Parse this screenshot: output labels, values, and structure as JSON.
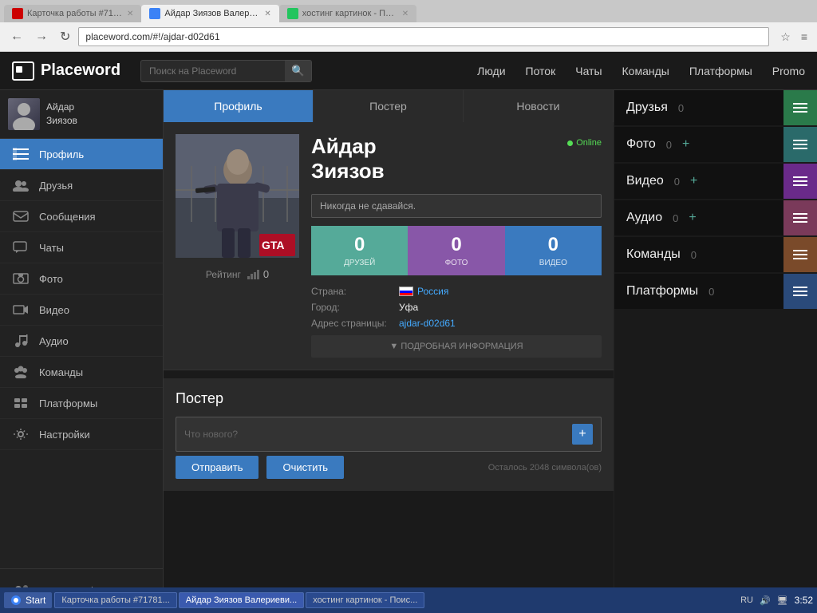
{
  "browser": {
    "tabs": [
      {
        "label": "Карточка работы #71781...",
        "favicon_color": "#c00",
        "active": false
      },
      {
        "label": "Айдар Зиязов Валериеви...",
        "favicon_color": "#3b82f6",
        "active": true
      },
      {
        "label": "хостинг картинок - Поис...",
        "favicon_color": "#22c55e",
        "active": false
      }
    ],
    "address": "placeword.com/#!/ajdar-d02d61",
    "back_btn": "←",
    "forward_btn": "→",
    "refresh_btn": "↻"
  },
  "navbar": {
    "logo": "Placeword",
    "search_placeholder": "Поиск на Placeword",
    "nav_links": [
      "Люди",
      "Поток",
      "Чаты",
      "Команды",
      "Платформы",
      "Promo"
    ]
  },
  "sidebar": {
    "user_name": "Айдар\nЗиязов",
    "items": [
      {
        "label": "Профиль",
        "icon": "☰",
        "active": true
      },
      {
        "label": "Друзья",
        "icon": "👥"
      },
      {
        "label": "Сообщения",
        "icon": "✉"
      },
      {
        "label": "Чаты",
        "icon": "💬"
      },
      {
        "label": "Фото",
        "icon": "🖼"
      },
      {
        "label": "Видео",
        "icon": "▶"
      },
      {
        "label": "Аудио",
        "icon": "♪"
      },
      {
        "label": "Команды",
        "icon": "👥"
      },
      {
        "label": "Платформы",
        "icon": "⬛"
      },
      {
        "label": "Настройки",
        "icon": "⚙"
      }
    ],
    "bottom_item": "Смена профиля"
  },
  "profile": {
    "tabs": [
      "Профиль",
      "Постер",
      "Новости"
    ],
    "active_tab": 0,
    "name": "Айдар\nЗиязов",
    "online_status": "Online",
    "motto": "Никогда не сдавайся.",
    "rating_label": "Рейтинг",
    "rating_value": "0",
    "stats": [
      {
        "number": "0",
        "label": "ДРУЗЕЙ",
        "color": "green"
      },
      {
        "number": "0",
        "label": "ФОТО",
        "color": "purple"
      },
      {
        "number": "0",
        "label": "ВИДЕО",
        "color": "blue"
      }
    ],
    "details": [
      {
        "key": "Страна:",
        "value": "Россия",
        "has_flag": true
      },
      {
        "key": "Город:",
        "value": "Уфа",
        "link": false
      },
      {
        "key": "Адрес страницы:",
        "value": "ajdar-d02d61",
        "link": true
      }
    ],
    "more_info": "▼ ПОДРОБНАЯ ИНФОРМАЦИЯ"
  },
  "poster": {
    "title": "Постер",
    "input_placeholder": "Что нового?",
    "submit_btn": "Отправить",
    "clear_btn": "Очистить",
    "chars_left": "Осталось 2048 символа(ов)"
  },
  "right_sidebar": {
    "widgets": [
      {
        "label": "Друзья",
        "count": "0",
        "has_add": false,
        "color": "green"
      },
      {
        "label": "Фото",
        "count": "0",
        "has_add": true,
        "color": "teal"
      },
      {
        "label": "Видео",
        "count": "0",
        "has_add": true,
        "color": "purple"
      },
      {
        "label": "Аудио",
        "count": "0",
        "has_add": true,
        "color": "pink"
      },
      {
        "label": "Команды",
        "count": "0",
        "has_add": false,
        "color": "orange"
      },
      {
        "label": "Платформы",
        "count": "0",
        "has_add": false,
        "color": "darkblue"
      }
    ]
  },
  "taskbar": {
    "items": [
      {
        "label": "Карточка работы #71781...",
        "active": false
      },
      {
        "label": "Айдар Зиязов Валериеви...",
        "active": true
      },
      {
        "label": "хостинг картинок - Поис...",
        "active": false
      }
    ],
    "system": {
      "lang": "RU",
      "time": "3:52"
    }
  }
}
